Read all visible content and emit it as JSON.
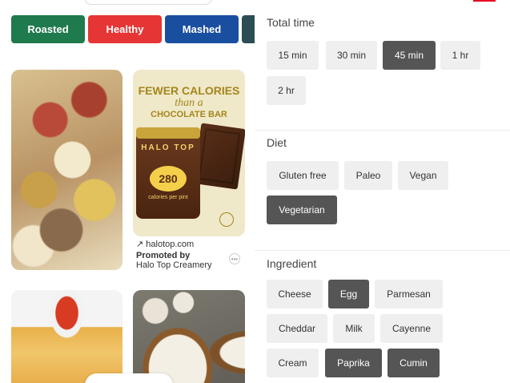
{
  "categories": {
    "chips": [
      {
        "label": "Roasted",
        "color": "#1f7a4e"
      },
      {
        "label": "Healthy",
        "color": "#e63535"
      },
      {
        "label": "Mashed",
        "color": "#1a4fa0"
      }
    ],
    "overflow_chip_color": "#2b4d53"
  },
  "ad": {
    "headline_1": "FEWER CALORIES",
    "headline_2": "than a",
    "headline_3": "CHOCOLATE BAR",
    "pint_brand": "HALO TOP",
    "pint_calories": "280",
    "pint_subtext": "calories per pint",
    "link": "halotop.com",
    "promoted": "Promoted by",
    "advertiser": "Halo Top Creamery",
    "more_icon": "dots-icon"
  },
  "filters": {
    "total_time": {
      "title": "Total time",
      "options": [
        {
          "label": "15 min",
          "selected": false
        },
        {
          "label": "30 min",
          "selected": false
        },
        {
          "label": "45 min",
          "selected": true
        },
        {
          "label": "1 hr",
          "selected": false
        },
        {
          "label": "2 hr",
          "selected": false
        }
      ]
    },
    "diet": {
      "title": "Diet",
      "options": [
        {
          "label": "Gluten free",
          "selected": false
        },
        {
          "label": "Paleo",
          "selected": false
        },
        {
          "label": "Vegan",
          "selected": false
        },
        {
          "label": "Vegetarian",
          "selected": true
        }
      ]
    },
    "ingredient": {
      "title": "Ingredient",
      "options": [
        {
          "label": "Cheese",
          "selected": false
        },
        {
          "label": "Egg",
          "selected": true
        },
        {
          "label": "Parmesan",
          "selected": false
        },
        {
          "label": "Cheddar",
          "selected": false
        },
        {
          "label": "Milk",
          "selected": false
        },
        {
          "label": "Cayenne",
          "selected": false
        },
        {
          "label": "Cream",
          "selected": false
        },
        {
          "label": "Paprika",
          "selected": true
        },
        {
          "label": "Cumin",
          "selected": true
        }
      ]
    }
  },
  "colors": {
    "selected_bg": "#555555",
    "unselected_bg": "#efefef",
    "accent": "#e60023"
  }
}
